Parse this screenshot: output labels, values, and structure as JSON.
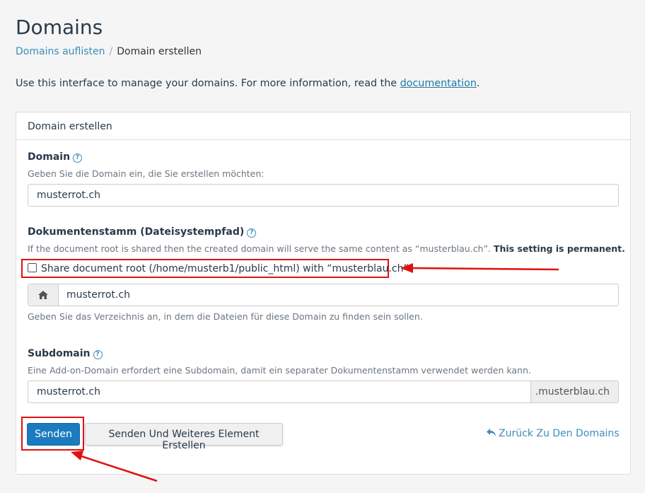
{
  "header": {
    "title": "Domains",
    "breadcrumb": {
      "link": "Domains auflisten",
      "separator": "/",
      "current": "Domain erstellen"
    },
    "intro_text": "Use this interface to manage your domains. For more information, read the ",
    "intro_link": "documentation",
    "intro_end": "."
  },
  "panel": {
    "heading": "Domain erstellen",
    "domain": {
      "label": "Domain",
      "hint": "Geben Sie die Domain ein, die Sie erstellen möchten:",
      "value": "musterrot.ch"
    },
    "docroot": {
      "label": "Dokumentenstamm (Dateisystempfad)",
      "hint": "If the document root is shared then the created domain will serve the same content as “musterblau.ch”.",
      "hint_bold": "This setting is permanent.",
      "checkbox_label": "Share document root (/home/musterb1/public_html) with “musterblau.ch”.",
      "checkbox_checked": false,
      "value": "musterrot.ch",
      "below_hint": "Geben Sie das Verzeichnis an, in dem die Dateien für diese Domain zu finden sein sollen."
    },
    "subdomain": {
      "label": "Subdomain",
      "hint": "Eine Add-on-Domain erfordert eine Subdomain, damit ein separater Dokumentenstamm verwendet werden kann.",
      "value": "musterrot.ch",
      "suffix": ".musterblau.ch"
    },
    "buttons": {
      "submit": "Senden",
      "submit_and_new": "Senden Und Weiteres Element Erstellen",
      "back": "Zurück Zu Den Domains"
    }
  },
  "colors": {
    "primary": "#1b7bc0",
    "link": "#3c8dbc",
    "annotation": "#e01010"
  },
  "icons": [
    "help-icon",
    "home-icon",
    "reply-arrow-icon",
    "annotation-arrow"
  ]
}
